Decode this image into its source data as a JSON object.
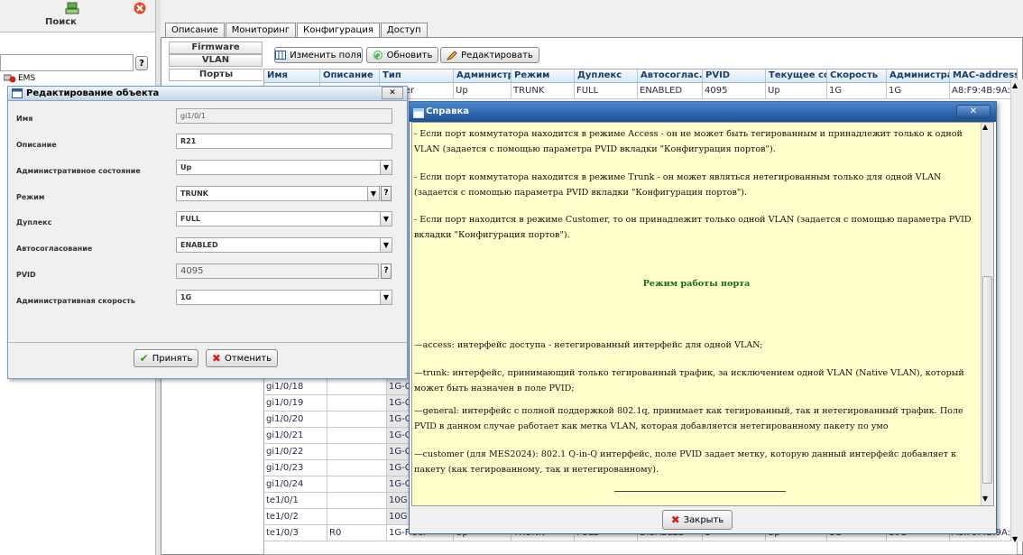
{
  "left_panel": {
    "search_label": "Поиск",
    "search_value": "",
    "tree_item": "EMS"
  },
  "main": {
    "tabs": [
      {
        "label": "Описание"
      },
      {
        "label": "Мониторинг"
      },
      {
        "label": "Конфигурация"
      },
      {
        "label": "Доступ"
      }
    ],
    "subtabs": [
      {
        "label": "Firmware"
      },
      {
        "label": "VLAN"
      },
      {
        "label": "Порты"
      }
    ],
    "toolbar": {
      "edit_fields": "Изменить поля",
      "refresh": "Обновить",
      "edit": "Редактировать"
    },
    "columns": [
      "Имя",
      "Описание",
      "Тип",
      "Администра...",
      "Режим",
      "Дуплекс",
      "Автосоглас...",
      "PVID",
      "Текущее со...",
      "Скорость",
      "Администра...",
      "MAC-address"
    ],
    "first_row": [
      "",
      "",
      "Copper",
      "Up",
      "TRUNK",
      "FULL",
      "ENABLED",
      "4095",
      "Up",
      "1G",
      "1G",
      "A8:F9:4B:9A:..."
    ],
    "visible_rows": [
      {
        "name": "gi1/0/18",
        "desc": "",
        "type": "1G-C"
      },
      {
        "name": "gi1/0/19",
        "desc": "",
        "type": "1G-C"
      },
      {
        "name": "gi1/0/20",
        "desc": "",
        "type": "1G-C"
      },
      {
        "name": "gi1/0/21",
        "desc": "",
        "type": "1G-C"
      },
      {
        "name": "gi1/0/22",
        "desc": "",
        "type": "1G-C"
      },
      {
        "name": "gi1/0/23",
        "desc": "",
        "type": "1G-C"
      },
      {
        "name": "gi1/0/24",
        "desc": "",
        "type": "1G-C"
      },
      {
        "name": "te1/0/1",
        "desc": "",
        "type": "10G"
      },
      {
        "name": "te1/0/2",
        "desc": "",
        "type": "10G"
      }
    ],
    "last_row": [
      "te1/0/3",
      "R0",
      "1G-Fiber",
      "Up",
      "TRUNK",
      "FULL",
      "DISABLED",
      "1",
      "Up",
      "1G",
      "10G",
      "A8:F9:4B:9A:..."
    ]
  },
  "edit_dialog": {
    "title": "Редактирование объекта",
    "fields": [
      {
        "label": "Имя",
        "value": "gi1/0/1"
      },
      {
        "label": "Описание",
        "value": "R21"
      },
      {
        "label": "Административное состояние",
        "value": "Up"
      },
      {
        "label": "Режим",
        "value": "TRUNK"
      },
      {
        "label": "Дуплекс",
        "value": "FULL"
      },
      {
        "label": "Автосогласование",
        "value": "ENABLED"
      },
      {
        "label": "PVID",
        "value": "4095"
      },
      {
        "label": "Административная скорость",
        "value": "1G"
      }
    ],
    "apply": "Принять",
    "cancel": "Отменить"
  },
  "help_dialog": {
    "title": "Справка",
    "p1": "- Если порт коммутатора находится в режиме Access - он не может быть тегированным и принадлежит только к одной VLAN (задается с помощью параметра PVID вкладки \"Конфигурация портов\").",
    "p2": "- Если порт коммутатора находится в режиме Trunk - он может являться нетегированным только для одной VLAN (задается с помощью параметра PVID вкладки \"Конфигурация портов\").",
    "p3": "- Если порт находится в режиме Customer, то он принадлежит только одной VLAN (задается с помощью параметра PVID вкладки \"Конфигурация портов\").",
    "heading": "Режим работы порта",
    "p4": "—access: интерфейс доступа - нетегированный интерфейс для одной VLAN;",
    "p5": "—trunk: интерфейс, принимающий только тегированный трафик, за исключением одной VLAN (Native VLAN), который может быть назначен в поле PVID;",
    "p6": "—general: интерфейс с полной поддержкой 802.1q, принимает как тегированный, так и нетегированный трафик. Поле PVID в данном случае работает как метка VLAN, которая добавляется нетегированному пакету по умо",
    "p7": "—customer (для MES2024): 802.1 Q-in-Q интерфейс, поле PVID задает метку, которую данный интерфейс добавляет к пакету (как тегированному, так и нетегированному).",
    "close": "Закрыть"
  },
  "colors": {
    "help_bg": "#ffffcc",
    "title_blue": "#1d4f92",
    "heading_green": "#1a6b1a",
    "cancel_red": "#d42020",
    "apply_green": "#3a9a22"
  }
}
